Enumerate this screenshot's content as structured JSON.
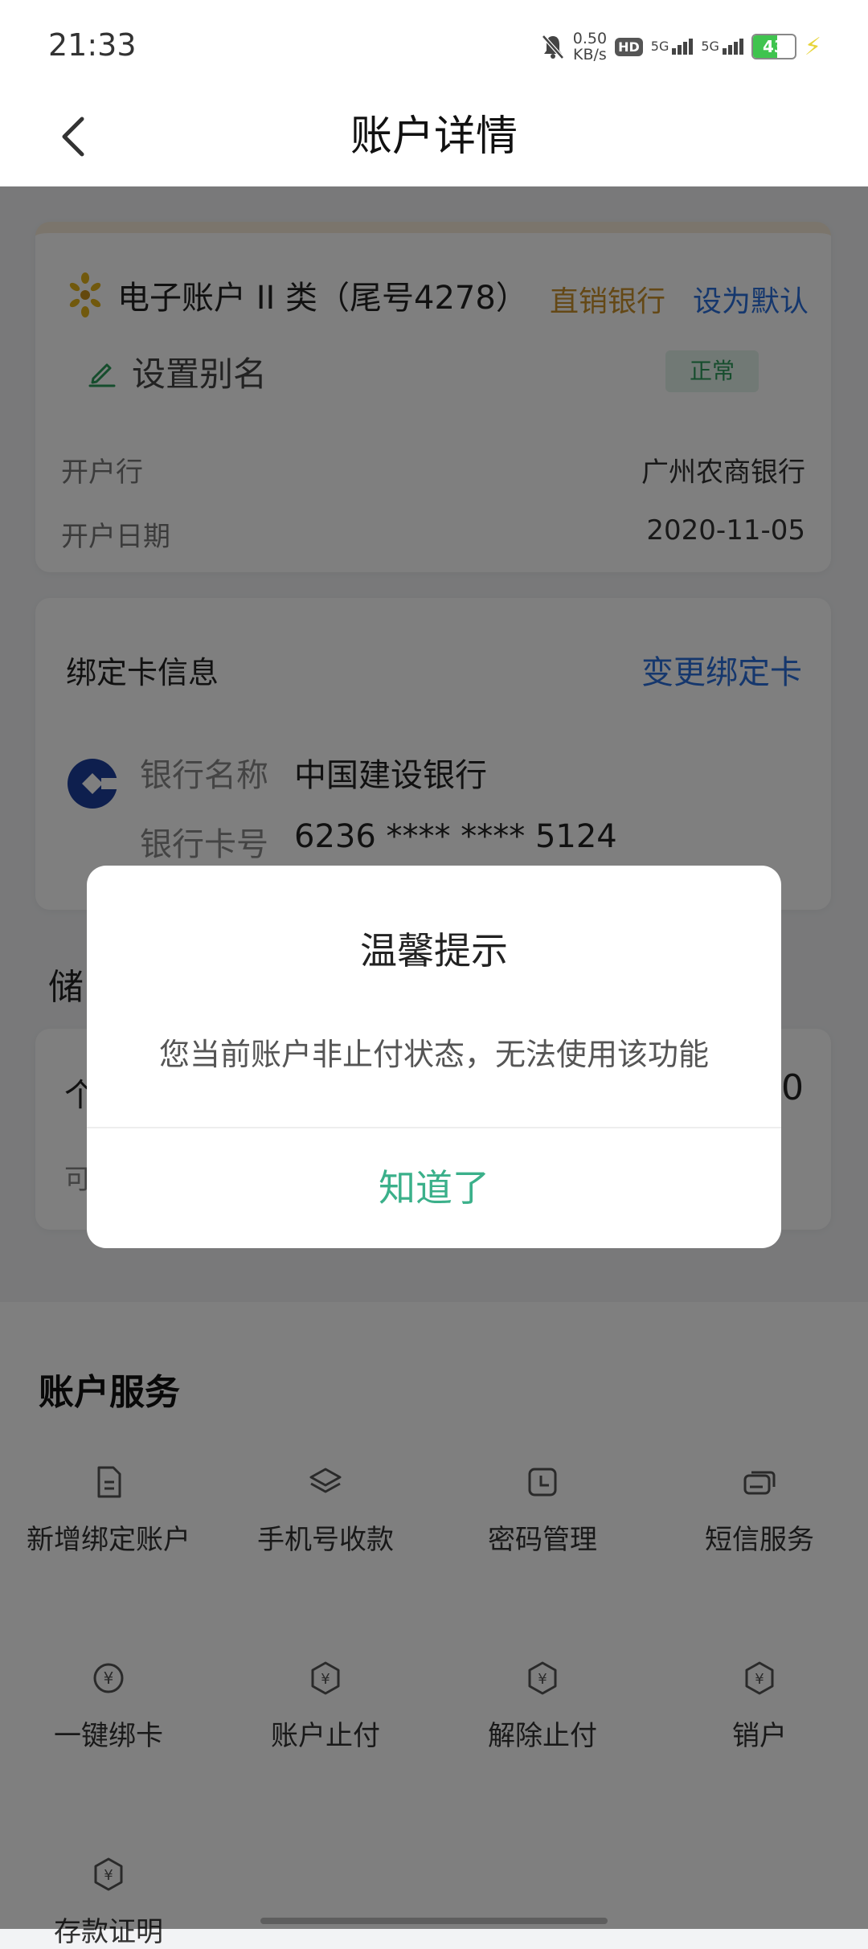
{
  "status_bar": {
    "time": "21:33",
    "net_speed_value": "0.50",
    "net_speed_unit": "KB/s",
    "hd_label": "HD",
    "sim1_label": "5G",
    "sim2_label": "5G",
    "battery_level": "43"
  },
  "nav": {
    "title": "账户详情"
  },
  "account_card": {
    "account_name": "电子账户 II 类（尾号4278）",
    "direct_bank_label": "直销银行",
    "set_default_label": "设为默认",
    "alias_label": "设置别名",
    "status_badge": "正常",
    "open_bank_label": "开户行",
    "open_bank_value": "广州农商银行",
    "open_date_label": "开户日期",
    "open_date_value": "2020-11-05"
  },
  "bind_card": {
    "title": "绑定卡信息",
    "change_label": "变更绑定卡",
    "bank_name_label": "银行名称",
    "bank_name_value": "中国建设银行",
    "card_no_label": "银行卡号",
    "card_no_value": "6236 **** **** 5124"
  },
  "savings_partial": {
    "section_fragment": "储",
    "row_fragment": "个",
    "amount_fragment": "0",
    "sub_fragment": "可"
  },
  "services": {
    "title": "账户服务",
    "items": [
      {
        "label": "新增绑定账户",
        "icon": "document-icon"
      },
      {
        "label": "手机号收款",
        "icon": "layers-icon"
      },
      {
        "label": "密码管理",
        "icon": "clock-icon"
      },
      {
        "label": "短信服务",
        "icon": "message-icon"
      },
      {
        "label": "一键绑卡",
        "icon": "yuan-circle-icon"
      },
      {
        "label": "账户止付",
        "icon": "yuan-hexagon-icon"
      },
      {
        "label": "解除止付",
        "icon": "yuan-hexagon-icon"
      },
      {
        "label": "销户",
        "icon": "yuan-hexagon-icon"
      },
      {
        "label": "存款证明",
        "icon": "yuan-hexagon-icon"
      }
    ]
  },
  "dialog": {
    "title": "温馨提示",
    "message": "您当前账户非止付状态，无法使用该功能",
    "confirm_label": "知道了"
  },
  "colors": {
    "accent_green": "#3bb08a",
    "link_blue": "#2a6fdb",
    "gold": "#c8902c"
  }
}
